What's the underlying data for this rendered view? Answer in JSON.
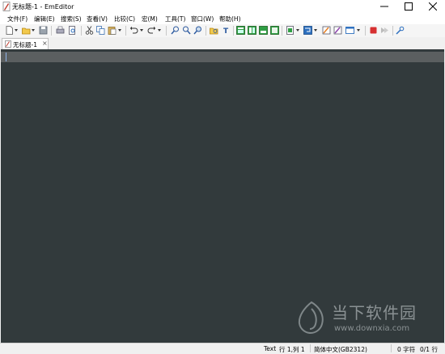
{
  "window": {
    "title": "无标题-1 - EmEditor"
  },
  "menu": [
    "文件(F)",
    "编辑(E)",
    "搜索(S)",
    "查看(V)",
    "比较(C)",
    "宏(M)",
    "工具(T)",
    "窗口(W)",
    "帮助(H)"
  ],
  "toolbar": {
    "icons": [
      "new-file-icon",
      "open-file-icon",
      "save-icon",
      "print-icon",
      "print-preview-icon",
      "cut-icon",
      "copy-icon",
      "paste-icon",
      "undo-icon",
      "redo-icon",
      "find-icon",
      "find-next-icon",
      "find-previous-icon",
      "find-in-files-icon",
      "highlight-icon",
      "layout-icon",
      "split-icon",
      "outline-icon",
      "bookmark-icon",
      "encoding-icon",
      "wrap-icon",
      "plugin-icon",
      "macro-record-icon",
      "macro-play-icon",
      "tools-icon"
    ]
  },
  "tabs": [
    {
      "label": "无标题-1",
      "close": "×"
    }
  ],
  "editor": {
    "background": "#323a3c",
    "current_line": "#5b5f60"
  },
  "watermark": {
    "brand": "当下软件园",
    "url": "www.downxia.com"
  },
  "status": {
    "mode": "Text",
    "position": "行 1,列 1",
    "encoding": "简体中文(GB2312)",
    "chars": "0 字符",
    "lines": "0/1 行"
  }
}
